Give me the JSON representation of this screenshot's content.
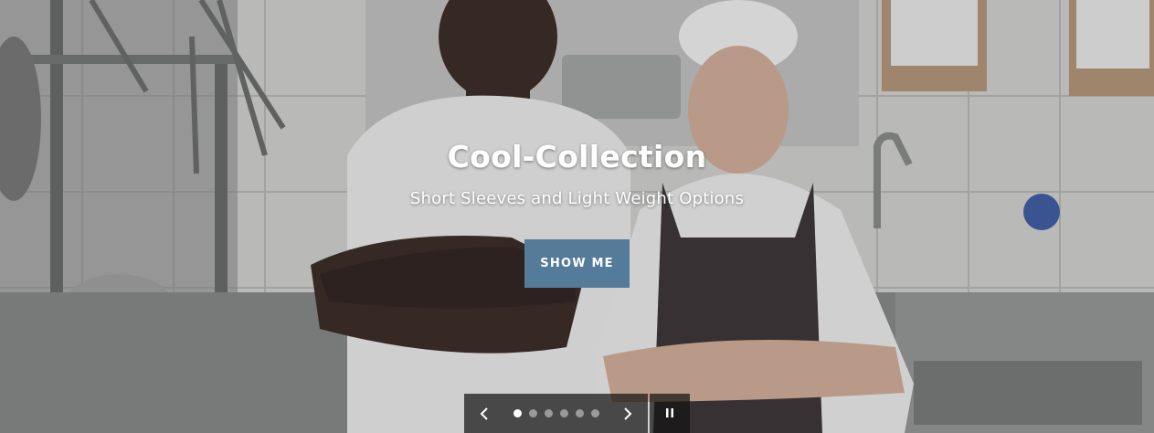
{
  "slideshow": {
    "title": "Cool-Collection",
    "subtitle": "Short Sleeves and Light Weight Options",
    "button_label": "SHOW ME",
    "button_color": "#557b9a",
    "slide_count": 6,
    "active_slide": 1,
    "controls": {
      "prev_icon": "chevron-left-icon",
      "next_icon": "chevron-right-icon",
      "pause_icon": "pause-icon"
    }
  }
}
